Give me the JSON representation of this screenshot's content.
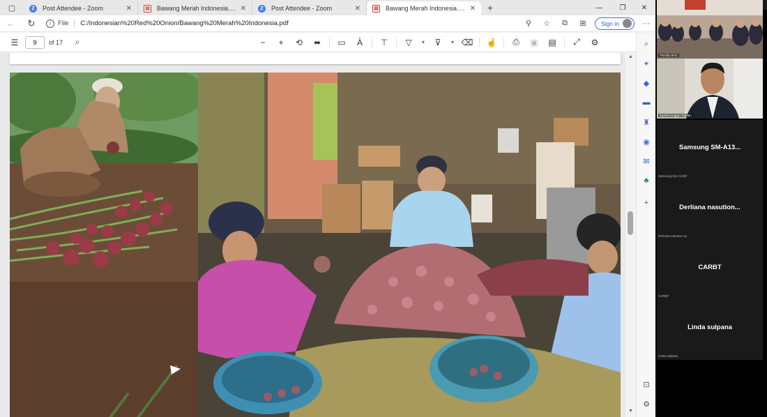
{
  "browser": {
    "tabs": [
      {
        "title": "Post Attendee - Zoom",
        "type": "zoom",
        "active": false
      },
      {
        "title": "Bawang Merah Indonesia.pdf",
        "type": "pdf",
        "active": false
      },
      {
        "title": "Post Attendee - Zoom",
        "type": "zoom",
        "active": false
      },
      {
        "title": "Bawang Merah Indonesia.pdf",
        "type": "pdf",
        "active": true
      }
    ],
    "new_tab_symbol": "+",
    "address": {
      "scheme_label": "File",
      "url": "C:/Indonesian%20Red%20Onion/Bawang%20Merah%20Indonesia.pdf",
      "sign_in_label": "Sign in"
    }
  },
  "pdf_viewer": {
    "current_page": "9",
    "page_total_label": "of 17"
  },
  "zoom": {
    "participants": [
      {
        "name": "Samsung  SM-A13...",
        "sub": "Samsung SM-A135F"
      },
      {
        "name": "Derliana  nasution...",
        "sub": "Derliana nasution sp"
      },
      {
        "name": "CARBT",
        "sub": "CARBT"
      },
      {
        "name": "Linda sulpana",
        "sub": "Linda sulpana"
      }
    ],
    "video_tiles": [
      {
        "label": "TRADE BTO"
      },
      {
        "label": "Syamil Lingga / Medan"
      }
    ]
  },
  "colors": {
    "accent": "#2a5cc4",
    "pdf_red": "#c7352a",
    "zoom_blue": "#4a7ee8",
    "zoom_bg": "#000000"
  }
}
